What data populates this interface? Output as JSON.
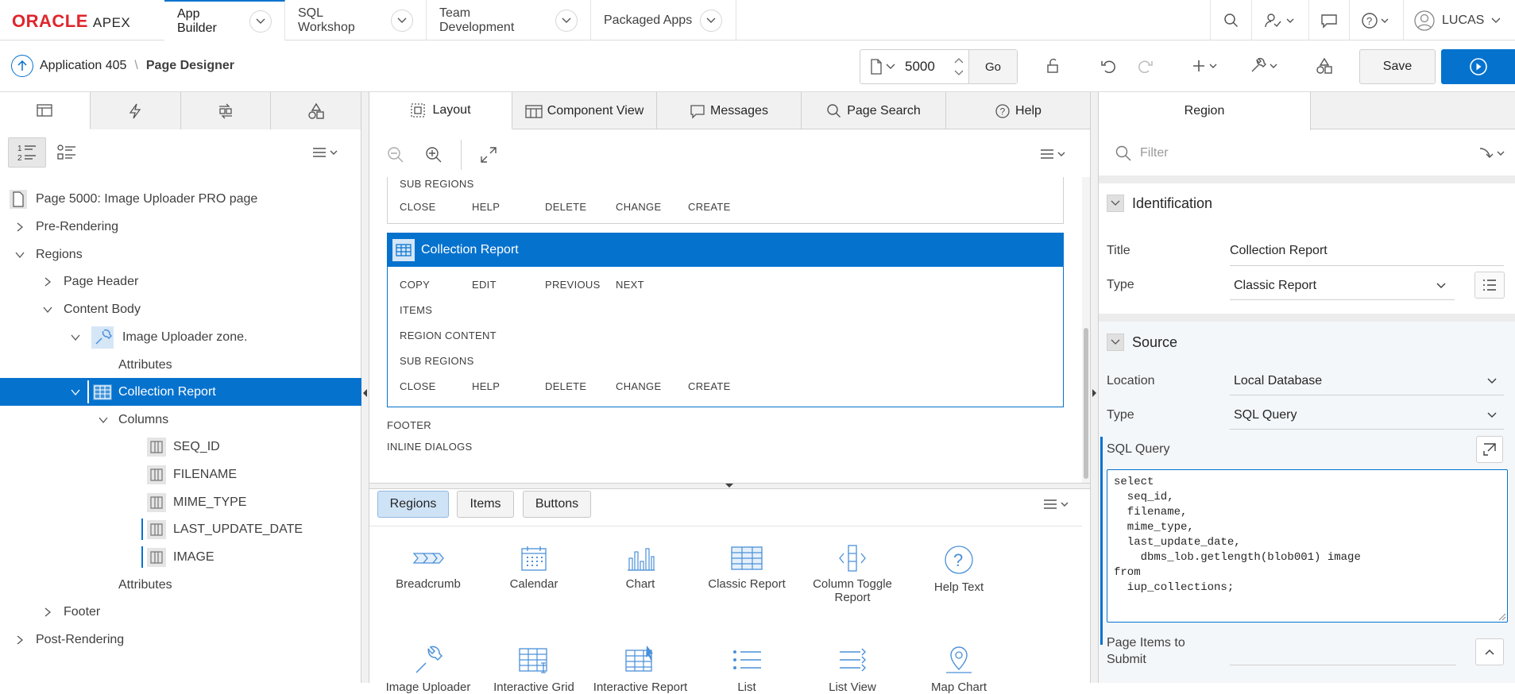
{
  "brand": {
    "logo": "ORACLE",
    "product": "APEX"
  },
  "nav": {
    "tabs": [
      "App Builder",
      "SQL Workshop",
      "Team Development",
      "Packaged Apps"
    ],
    "user": "LUCAS"
  },
  "toolbar": {
    "app_crumb": "Application 405",
    "page_crumb": "Page Designer",
    "page_number": "5000",
    "go_label": "Go",
    "save_label": "Save"
  },
  "left": {
    "tree": {
      "page": "Page 5000: Image Uploader PRO page",
      "pre_rendering": "Pre-Rendering",
      "regions": "Regions",
      "page_header": "Page Header",
      "content_body": "Content Body",
      "image_zone": "Image Uploader zone.",
      "attributes": "Attributes",
      "collection_report": "Collection Report",
      "columns": "Columns",
      "cols": [
        "SEQ_ID",
        "FILENAME",
        "MIME_TYPE",
        "LAST_UPDATE_DATE",
        "IMAGE"
      ],
      "attributes2": "Attributes",
      "footer": "Footer",
      "post_rendering": "Post-Rendering"
    }
  },
  "middle": {
    "tabs": [
      "Layout",
      "Component View",
      "Messages",
      "Page Search",
      "Help"
    ],
    "layout": {
      "top_sub_regions": "SUB REGIONS",
      "top_row": [
        "CLOSE",
        "HELP",
        "DELETE",
        "CHANGE",
        "CREATE"
      ],
      "region_title": "Collection Report",
      "row1": [
        "COPY",
        "EDIT",
        "PREVIOUS",
        "NEXT"
      ],
      "items": "ITEMS",
      "region_content": "REGION CONTENT",
      "sub_regions": "SUB REGIONS",
      "row2": [
        "CLOSE",
        "HELP",
        "DELETE",
        "CHANGE",
        "CREATE"
      ],
      "footer": "FOOTER",
      "inline_dialogs": "INLINE DIALOGS"
    },
    "gallery": {
      "tabs": [
        "Regions",
        "Items",
        "Buttons"
      ],
      "items_row1": [
        "Breadcrumb",
        "Calendar",
        "Chart",
        "Classic Report",
        "Column Toggle Report",
        "Help Text"
      ],
      "items_row2": [
        "Image Uploader",
        "Interactive Grid",
        "Interactive Report",
        "List",
        "List View",
        "Map Chart"
      ]
    }
  },
  "right": {
    "tab": "Region",
    "filter_placeholder": "Filter",
    "identification": {
      "heading": "Identification",
      "title_label": "Title",
      "title_value": "Collection Report",
      "type_label": "Type",
      "type_value": "Classic Report"
    },
    "source": {
      "heading": "Source",
      "location_label": "Location",
      "location_value": "Local Database",
      "type_label": "Type",
      "type_value": "SQL Query",
      "sql_label": "SQL Query",
      "sql": "select\n  seq_id,\n  filename,\n  mime_type,\n  last_update_date,\n    dbms_lob.getlength(blob001) image\nfrom\n  iup_collections;",
      "page_items_label": "Page Items to Submit"
    }
  },
  "colors": {
    "accent": "#0572ce",
    "oracle_red": "#e0252b"
  }
}
